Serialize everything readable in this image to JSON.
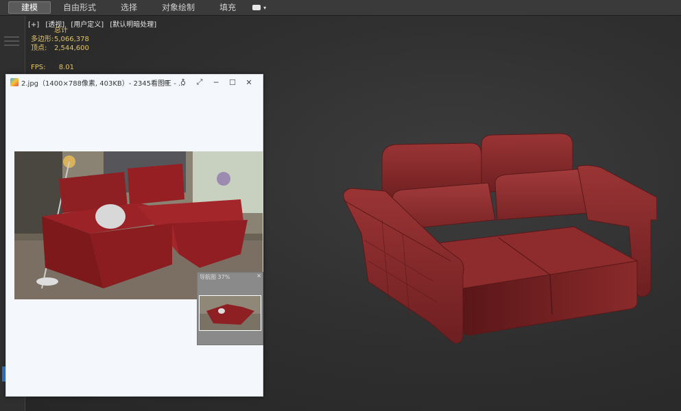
{
  "toolbar": {
    "tabs": [
      "建模",
      "自由形式",
      "选择",
      "对象绘制",
      "填充"
    ],
    "active_tab": "建模"
  },
  "viewport": {
    "labels": [
      "[+]",
      "[透视]",
      "[用户定义]",
      "[默认明暗处理]"
    ],
    "stats": {
      "header": "总计",
      "polygons_label": "多边形:",
      "polygons_value": "5,066,378",
      "vertices_label": "顶点:",
      "vertices_value": "2,544,600",
      "fps_label": "FPS:",
      "fps_value": "8.01"
    },
    "model_color": "#8a2a2b"
  },
  "viewer": {
    "title": "2.jpg（1400×788像素, 403KB）- 2345看图王 - ...",
    "thumbnail_title": "导航图 37%"
  }
}
